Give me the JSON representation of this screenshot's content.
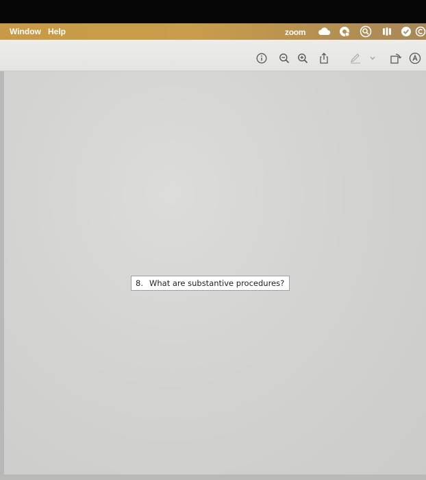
{
  "menubar": {
    "items": [
      {
        "label": "Window"
      },
      {
        "label": "Help"
      }
    ],
    "tray": {
      "zoom_label": "zoom",
      "icons": [
        "cloud-icon",
        "gear-badge-icon",
        "search-circle-icon",
        "paw-icon",
        "checkmark-circle-icon",
        "circle-icon"
      ]
    }
  },
  "toolbar": {
    "icons": [
      "info-icon",
      "zoom-out-icon",
      "zoom-in-icon",
      "share-icon",
      "markup-pen-icon",
      "chevron-down-icon",
      "rotate-icon",
      "annotate-circle-icon"
    ]
  },
  "document": {
    "question_number": "8.",
    "question_text": "What are substantive procedures?"
  },
  "colors": {
    "menubar_accent": "#c89a45",
    "toolbar_bg": "#e8e8e6",
    "content_bg": "#d3d3d1"
  }
}
